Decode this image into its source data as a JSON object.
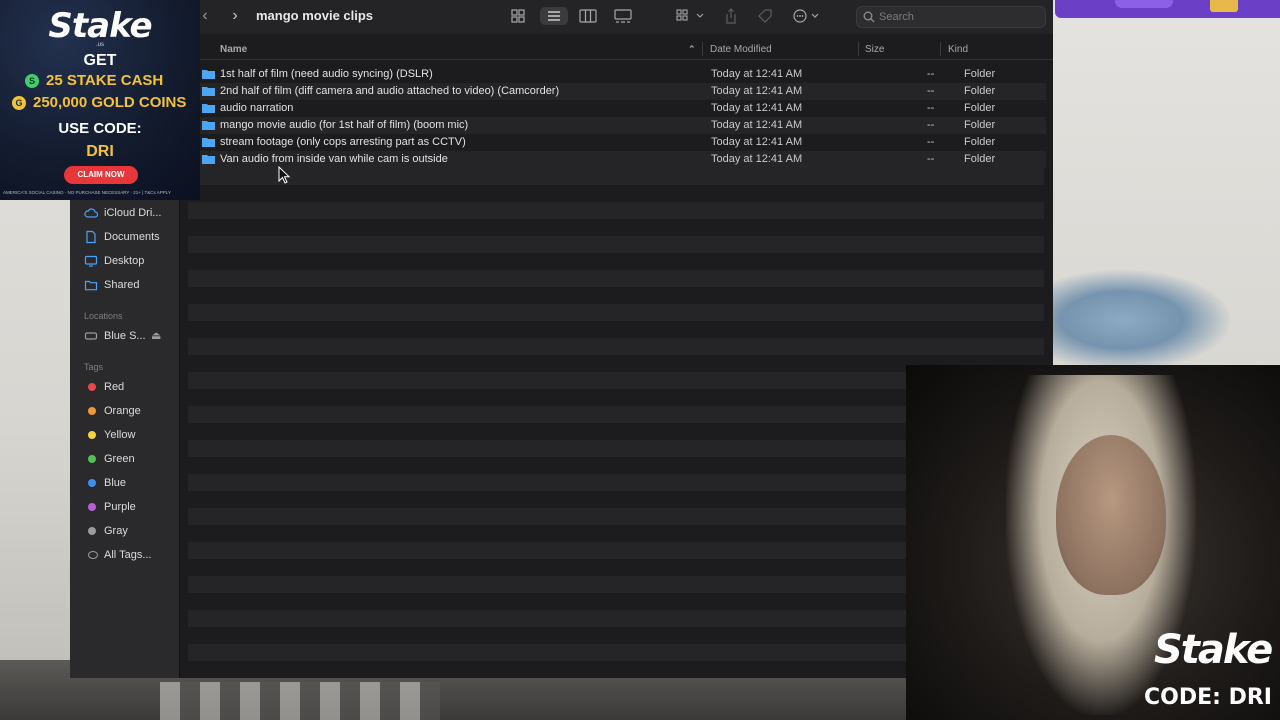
{
  "finder": {
    "title": "mango movie clips",
    "nav": {
      "back": "‹",
      "forward": "›"
    },
    "search_placeholder": "Search",
    "columns": {
      "name": "Name",
      "date_modified": "Date Modified",
      "size": "Size",
      "kind": "Kind"
    },
    "rows": [
      {
        "name": "1st half of film (need audio syncing) (DSLR)",
        "date": "Today at 12:41 AM",
        "size": "--",
        "kind": "Folder"
      },
      {
        "name": "2nd half of film (diff camera and audio attached to video) (Camcorder)",
        "date": "Today at 12:41 AM",
        "size": "--",
        "kind": "Folder"
      },
      {
        "name": "audio narration",
        "date": "Today at 12:41 AM",
        "size": "--",
        "kind": "Folder"
      },
      {
        "name": "mango movie audio (for 1st half of film) (boom mic)",
        "date": "Today at 12:41 AM",
        "size": "--",
        "kind": "Folder"
      },
      {
        "name": "stream footage (only cops arresting part as CCTV)",
        "date": "Today at 12:41 AM",
        "size": "--",
        "kind": "Folder"
      },
      {
        "name": "Van audio from inside van while cam is outside",
        "date": "Today at 12:41 AM",
        "size": "--",
        "kind": "Folder"
      }
    ]
  },
  "sidebar": {
    "items": [
      {
        "label": "iCloud Dri...",
        "icon": "cloud-icon"
      },
      {
        "label": "Documents",
        "icon": "document-icon"
      },
      {
        "label": "Desktop",
        "icon": "desktop-icon"
      },
      {
        "label": "Shared",
        "icon": "shared-folder-icon"
      }
    ],
    "locations_title": "Locations",
    "locations": [
      {
        "label": "Blue S...",
        "icon": "drive-icon",
        "eject": "⏏"
      }
    ],
    "tags_title": "Tags",
    "tags": [
      {
        "label": "Red",
        "color": "#e8484a"
      },
      {
        "label": "Orange",
        "color": "#f09a37"
      },
      {
        "label": "Yellow",
        "color": "#f5d33b"
      },
      {
        "label": "Green",
        "color": "#52c15a"
      },
      {
        "label": "Blue",
        "color": "#3b8ff0"
      },
      {
        "label": "Purple",
        "color": "#b65fd6"
      },
      {
        "label": "Gray",
        "color": "#9b9b9e"
      }
    ],
    "all_tags": "All Tags..."
  },
  "ad": {
    "logo": "Stake",
    "logo_sub": ".us",
    "get": "GET",
    "line1_coin": "S",
    "line1": "25 STAKE CASH",
    "line2_coin": "G",
    "line2": "250,000 GOLD COINS",
    "use_code": "USE CODE:",
    "code": "DRI",
    "claim": "CLAIM NOW",
    "fine_print": "AMERICA'S SOCIAL CASINO · NO PURCHASE NECESSARY · 21+ | T&Cs APPLY"
  },
  "watermark": {
    "logo": "Stake",
    "code": "CODE: DRI"
  },
  "colors": {
    "accent": "#3b8ff0",
    "ad_gold": "#f3c335",
    "claim_red": "#e8373a"
  }
}
